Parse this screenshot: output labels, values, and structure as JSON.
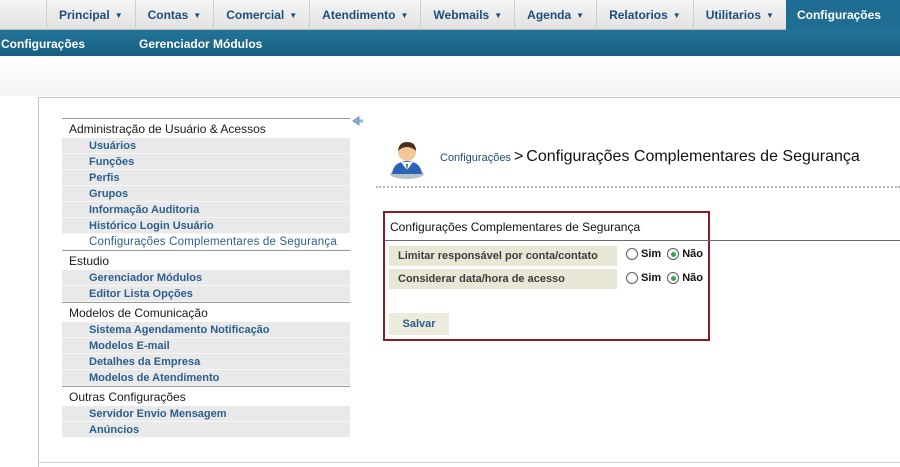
{
  "top_nav": {
    "tabs": [
      {
        "label": "Principal"
      },
      {
        "label": "Contas"
      },
      {
        "label": "Comercial"
      },
      {
        "label": "Atendimento"
      },
      {
        "label": "Webmails"
      },
      {
        "label": "Agenda"
      },
      {
        "label": "Relatorios"
      },
      {
        "label": "Utilitarios"
      },
      {
        "label": "Configurações",
        "active": true
      }
    ],
    "active_color": "#1f6d93"
  },
  "sub_nav": {
    "items": [
      "Configurações",
      "Gerenciador Módulos"
    ],
    "bg_color": "#1f6d93"
  },
  "sidebar": {
    "sections": [
      {
        "title": "Administração de Usuário & Acessos",
        "items": [
          "Usuários",
          "Funções",
          "Perfis",
          "Grupos",
          "Informação Auditoria",
          "Histórico Login Usuário",
          "Configurações Complementares de Segurança"
        ],
        "selected": "Configurações Complementares de Segurança"
      },
      {
        "title": "Estudio",
        "items": [
          "Gerenciador Módulos",
          "Editor Lista Opções"
        ]
      },
      {
        "title": "Modelos de Comunicação",
        "items": [
          "Sistema Agendamento Notificação",
          "Modelos E-mail",
          "Detalhes da Empresa",
          "Modelos de Atendimento"
        ]
      },
      {
        "title": "Outras Configurações",
        "items": [
          "Servidor Envio Mensagem",
          "Anúncios"
        ]
      }
    ]
  },
  "header": {
    "breadcrumb_link": "Configurações",
    "separator": ">",
    "title": "Configurações Complementares de Segurança",
    "icon": "user-avatar-icon"
  },
  "form": {
    "title": "Configurações Complementares de Segurança",
    "border_color": "#8b1c25",
    "rows": [
      {
        "label": "Limitar responsável por conta/contato",
        "yes": "Sim",
        "no": "Não",
        "selected": "Não"
      },
      {
        "label": "Considerar data/hora de acesso",
        "yes": "Sim",
        "no": "Não",
        "selected": "Não"
      }
    ],
    "save_label": "Salvar"
  }
}
